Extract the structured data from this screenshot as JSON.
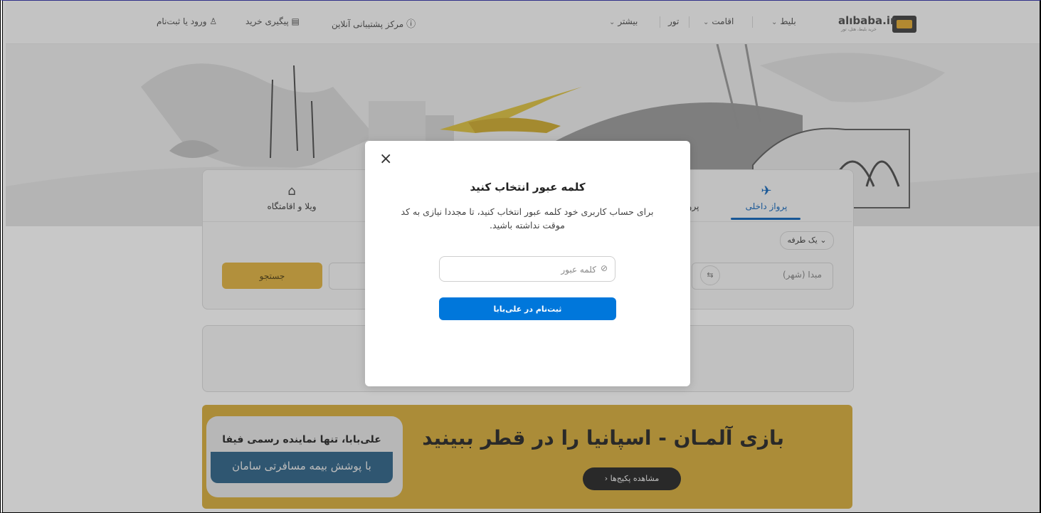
{
  "header": {
    "logo_text": "alıbaba.ir",
    "logo_sub": "خرید بلیط، هتل، تور",
    "nav": [
      "بلیط",
      "اقامت",
      "تور",
      "بیشتر"
    ],
    "support": "مرکز پشتیبانی آنلاین",
    "tracking": "پیگیری خرید",
    "login": "ورود یا ثبت‌نام"
  },
  "tabs": {
    "domestic_flight": "پرواز داخلی",
    "partial_flight": "پرواز",
    "villa": "ویلا و اقامتگاه"
  },
  "search": {
    "trip_type": "یک طرفه",
    "origin_placeholder": "مبدا (شهر)",
    "search_button": "جستجو"
  },
  "banner": {
    "title": "بازی آلمـان - اسپانیا را در قطر ببینید",
    "button": "مشاهده پکیج‌ها",
    "badge_top": "علی‌بابا، تنها نماینده رسمی فیفا",
    "badge_bottom": "با پوشش بیمه مسافرتی سامان"
  },
  "modal": {
    "close": "×",
    "title": "کلمه عبور انتخاب کنید",
    "description": "برای حساب کاربری خود کلمه عبور انتخاب کنید، تا مجددا نیازی به کد موقت نداشته باشید.",
    "password_placeholder": "کلمه عبور",
    "submit": "ثبت‌نام در علی‌بابا"
  },
  "colors": {
    "primary": "#0077db",
    "accent": "#d9b04a",
    "active_tab": "#1e6bb8"
  }
}
